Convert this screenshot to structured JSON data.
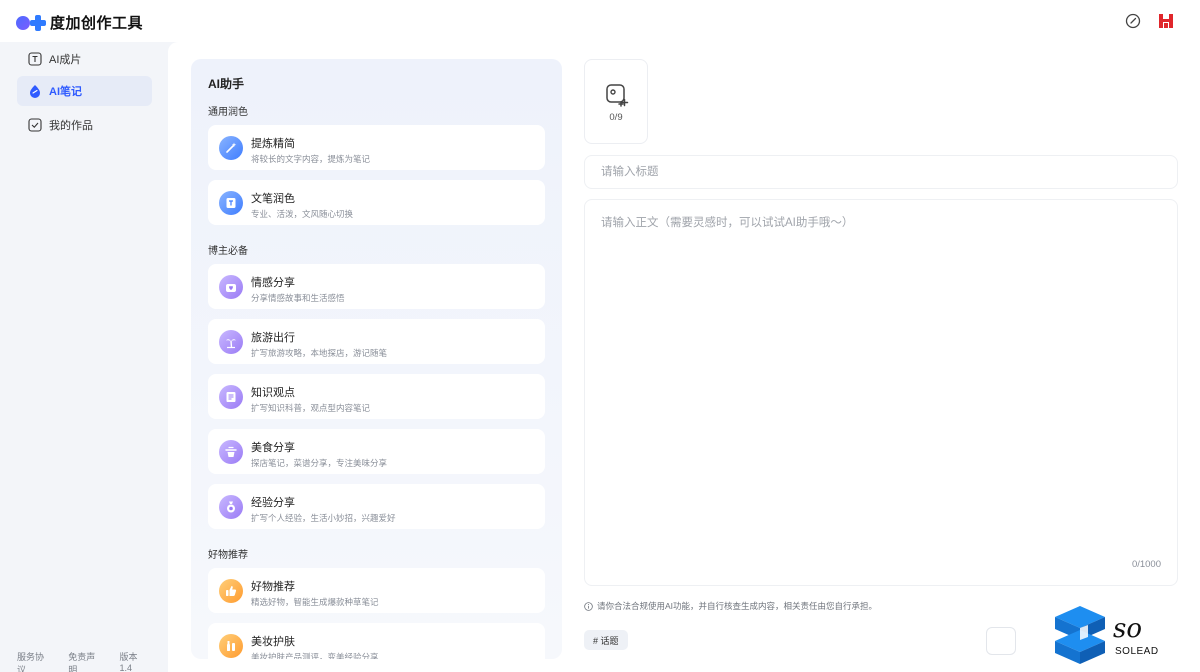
{
  "header": {
    "app_name": "度加创作工具",
    "edit_icon": "edit-pen-icon",
    "brand_icon": "baidu-brand-icon"
  },
  "sidebar": {
    "items": [
      {
        "label": "AI成片",
        "icon": "text-t-icon",
        "active": false
      },
      {
        "label": "AI笔记",
        "icon": "note-drop-icon",
        "active": true
      },
      {
        "label": "我的作品",
        "icon": "check-box-icon",
        "active": false
      }
    ],
    "footer": [
      "服务协议",
      "免责声明",
      "版本 1.4"
    ]
  },
  "assistant": {
    "title": "AI助手",
    "sections": [
      {
        "title": "通用润色",
        "cards": [
          {
            "title": "提炼精简",
            "desc": "将较长的文字内容，提炼为笔记",
            "color": "blue"
          },
          {
            "title": "文笔润色",
            "desc": "专业、活泼，文风随心切换",
            "color": "blue"
          }
        ]
      },
      {
        "title": "博主必备",
        "cards": [
          {
            "title": "情感分享",
            "desc": "分享情感故事和生活感悟",
            "color": "purple"
          },
          {
            "title": "旅游出行",
            "desc": "扩写旅游攻略，本地探店，游记随笔",
            "color": "purple"
          },
          {
            "title": "知识观点",
            "desc": "扩写知识科普，观点型内容笔记",
            "color": "purple"
          },
          {
            "title": "美食分享",
            "desc": "探店笔记，菜谱分享，专注美味分享",
            "color": "purple"
          },
          {
            "title": "经验分享",
            "desc": "扩写个人经验，生活小妙招，兴趣爱好",
            "color": "purple"
          }
        ]
      },
      {
        "title": "好物推荐",
        "cards": [
          {
            "title": "好物推荐",
            "desc": "精选好物，智能生成爆款种草笔记",
            "color": "orange"
          },
          {
            "title": "美妆护肤",
            "desc": "美妆护肤产品测评，变美经验分享",
            "color": "orange"
          }
        ]
      }
    ]
  },
  "editor": {
    "image_count": "0/9",
    "title_placeholder": "请输入标题",
    "body_placeholder": "请输入正文（需要灵感时，可以试试AI助手哦～）",
    "char_count": "0/1000",
    "notice": "请你合法合规使用AI功能，并自行核查生成内容，相关责任由您自行承担。",
    "topic_tag": "# 话题"
  },
  "watermark": {
    "text1": "so",
    "text2": "SOLEAD"
  }
}
